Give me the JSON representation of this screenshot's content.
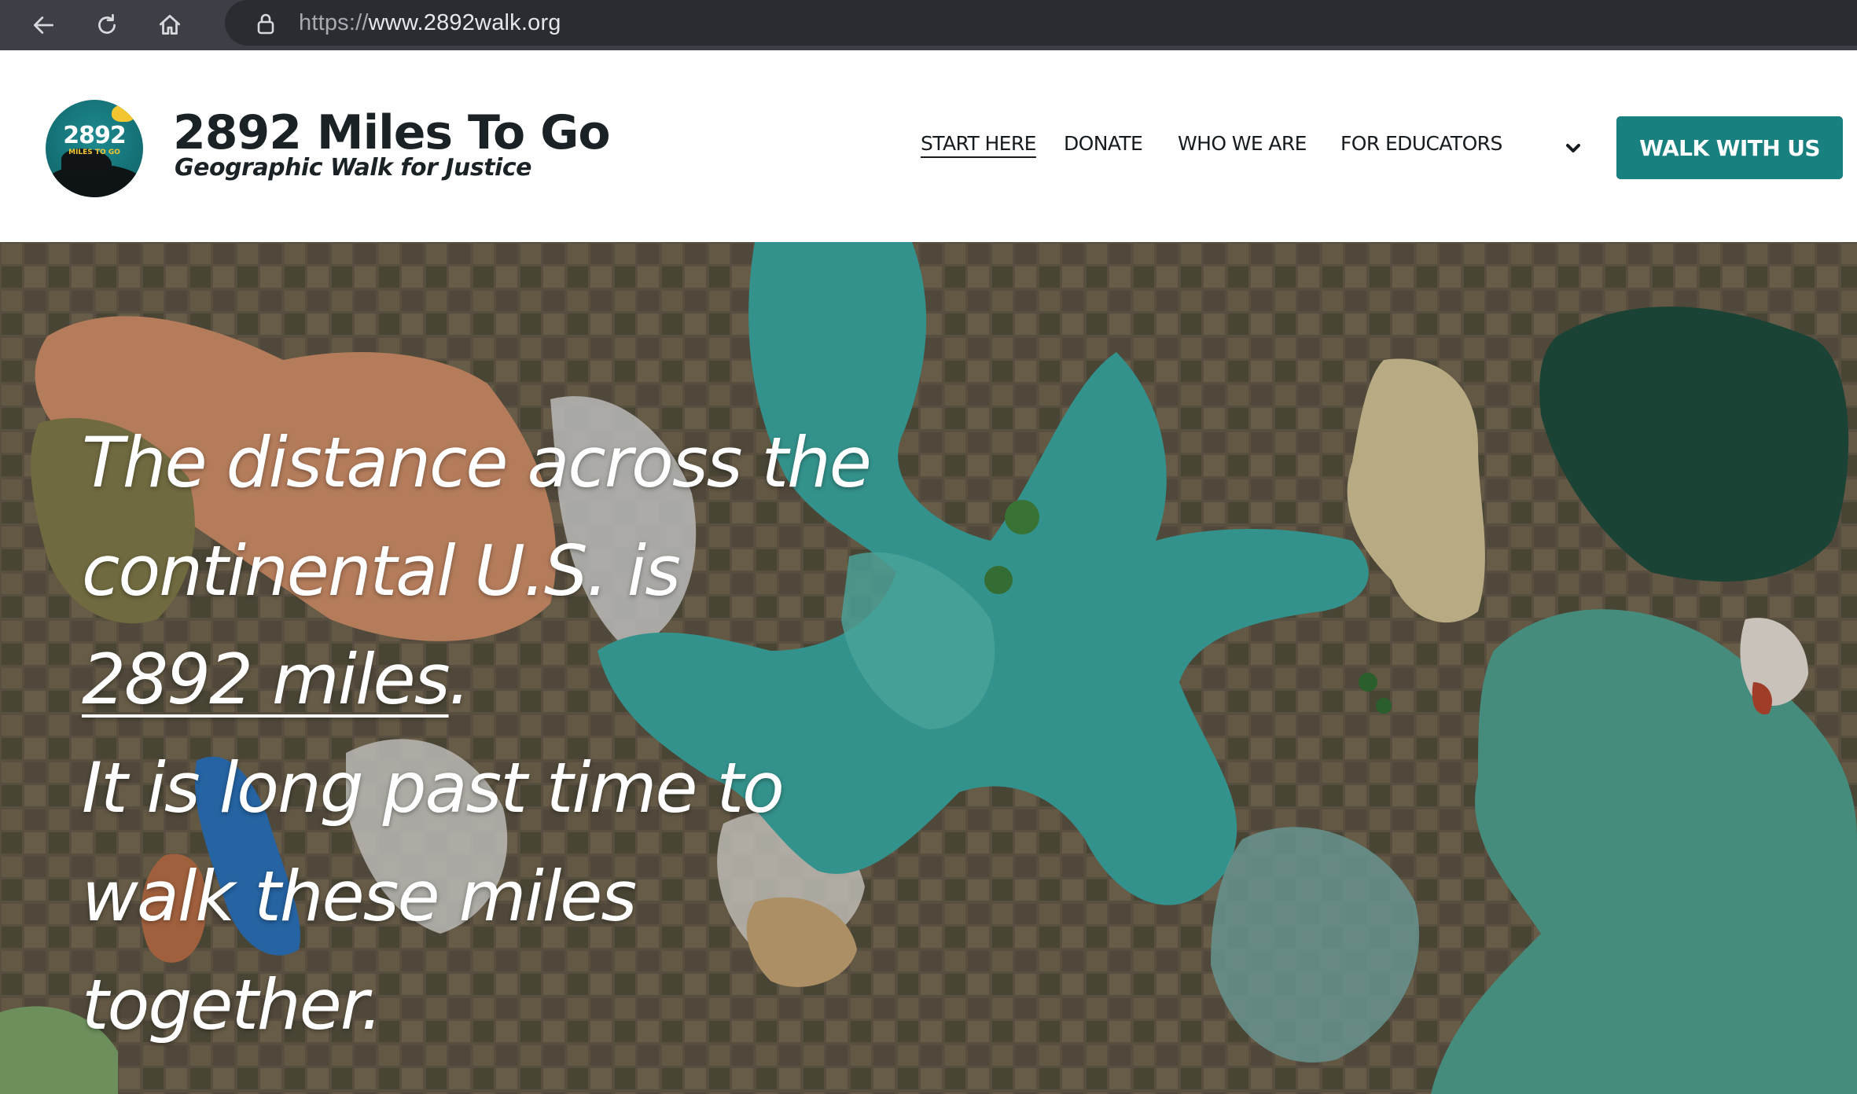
{
  "browser": {
    "url_scheme": "https://",
    "url_host": "www.2892walk.org"
  },
  "header": {
    "logo_number": "2892",
    "logo_subtext": "MILES TO GO",
    "site_title": "2892 Miles To Go",
    "tagline": "Geographic Walk for Justice",
    "nav": [
      {
        "label": "START HERE",
        "active": true
      },
      {
        "label": "DONATE"
      },
      {
        "label": "WHO WE ARE"
      },
      {
        "label": "FOR EDUCATORS"
      }
    ],
    "cta_label": "WALK WITH US"
  },
  "hero": {
    "line1": "The distance across the",
    "line2": "continental U.S. is",
    "link_text": "2892 miles",
    "link_suffix": ".",
    "line4": "It is long past time to",
    "line5": "walk these miles",
    "line6": "together."
  },
  "colors": {
    "accent": "#18807f",
    "chrome": "#3c3f45",
    "text_dark": "#1b2226"
  },
  "icons": [
    "back-arrow-icon",
    "reload-icon",
    "home-icon",
    "lock-icon",
    "chevron-down-icon"
  ]
}
